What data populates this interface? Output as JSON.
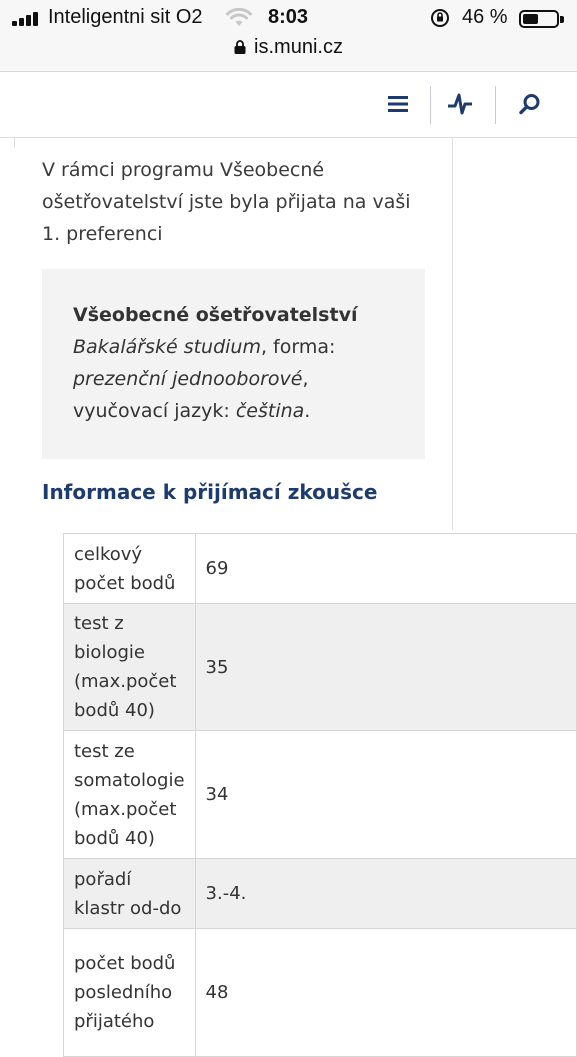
{
  "status_bar": {
    "carrier": "Inteligentni sit O2",
    "time": "8:03",
    "battery_percent": "46 %",
    "battery_level": 0.46,
    "url": "is.muni.cz"
  },
  "app_bar": {
    "icons": [
      "menu-icon",
      "pulse-icon",
      "search-icon"
    ]
  },
  "intro_text": "V rámci programu Všeobecné ošetřovatelství jste byla přijata na vaši 1. preferenci",
  "program": {
    "name": "Všeobecné ošetřovatelství",
    "study_type": "Bakalářské studium",
    "form_label": ", forma:",
    "form_value": "prezenční jednooborové",
    "lang_label": ", vyučovací jazyk:",
    "lang_value": "čeština",
    "end": "."
  },
  "section_title": "Informace k přijímací zkoušce",
  "exam_table": [
    {
      "label": "celkový počet bodů",
      "value": "69"
    },
    {
      "label": "test z biologie (max.počet bodů 40)",
      "value": "35"
    },
    {
      "label": "test ze somatologie (max.počet bodů 40)",
      "value": "34"
    },
    {
      "label": "pořadí klastr od-do",
      "value": "3.-4."
    },
    {
      "label": "počet bodů posledního přijatého",
      "value": "48"
    }
  ],
  "colors": {
    "title_blue": "#1e3b70",
    "icon_blue": "#1e3b70",
    "card_bg": "#f3f3f3",
    "alt_row_bg": "#efefef"
  }
}
